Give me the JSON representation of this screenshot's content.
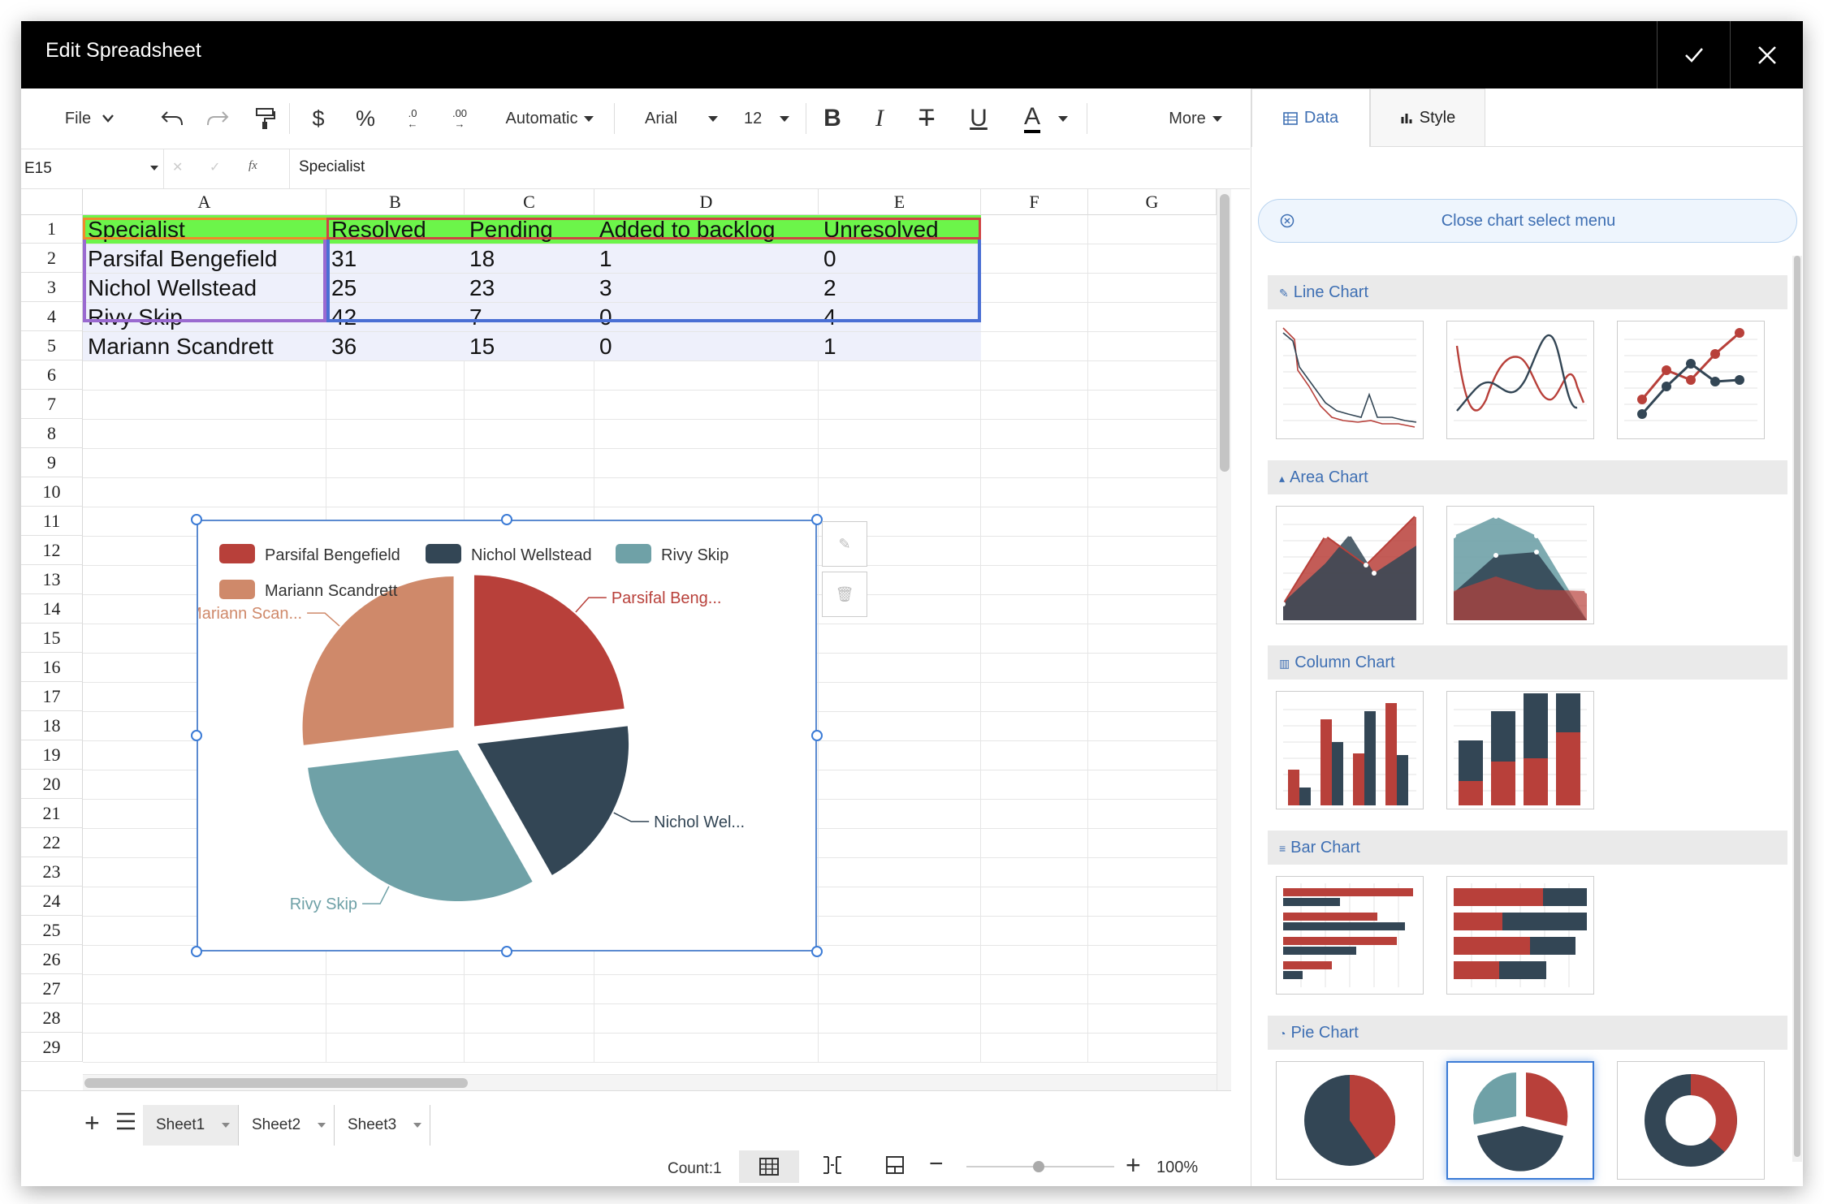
{
  "window": {
    "title": "Edit Spreadsheet"
  },
  "toolbar": {
    "file_label": "File",
    "number_format": "Automatic",
    "font_name": "Arial",
    "font_size": "12",
    "more_label": "More",
    "currency_symbol": "$",
    "percent_symbol": "%",
    "decrease_decimal": ".0",
    "increase_decimal": ".00"
  },
  "formula_bar": {
    "cell_ref": "E15",
    "fx_label": "fx",
    "content": "Specialist"
  },
  "sheet": {
    "columns": [
      "A",
      "B",
      "C",
      "D",
      "E",
      "F",
      "G"
    ],
    "rows": [
      "1",
      "2",
      "3",
      "4",
      "5",
      "6",
      "7",
      "8",
      "9",
      "10",
      "11",
      "12",
      "13",
      "14",
      "15",
      "16",
      "17",
      "18",
      "19",
      "20",
      "21",
      "22",
      "23",
      "24",
      "25",
      "26",
      "27",
      "28",
      "29"
    ],
    "header": [
      "Specialist",
      "Resolved",
      "Pending",
      "Added to backlog",
      "Unresolved"
    ],
    "data": [
      [
        "Parsifal Bengefield",
        "31",
        "18",
        "1",
        "0"
      ],
      [
        "Nichol Wellstead",
        "25",
        "23",
        "3",
        "2"
      ],
      [
        "Rivy Skip",
        "42",
        "7",
        "0",
        "4"
      ],
      [
        "Mariann Scandrett",
        "36",
        "15",
        "0",
        "1"
      ]
    ],
    "header_bg": "#6cf54a",
    "body_bg": "#eef0fb"
  },
  "chart_data": {
    "type": "pie",
    "legend_position": "top-left",
    "slices": [
      {
        "name": "Parsifal Bengefield",
        "label": "Parsifal Beng...",
        "value": 31,
        "color": "#b8403a"
      },
      {
        "name": "Nichol Wellstead",
        "label": "Nichol Wel...",
        "value": 25,
        "color": "#334655"
      },
      {
        "name": "Rivy Skip",
        "label": "Rivy Skip",
        "value": 42,
        "color": "#6fa1a7"
      },
      {
        "name": "Mariann Scandrett",
        "label": "Mariann Scan...",
        "value": 36,
        "color": "#cf896a"
      }
    ]
  },
  "status": {
    "count_label": "Count:1",
    "zoom": "100%",
    "tabs": [
      "Sheet1",
      "Sheet2",
      "Sheet3"
    ],
    "active_tab": "Sheet1"
  },
  "panel": {
    "tabs": [
      "Data",
      "Style"
    ],
    "close_menu_label": "Close chart select menu",
    "sections": [
      "Line Chart",
      "Area Chart",
      "Column Chart",
      "Bar Chart",
      "Pie Chart"
    ]
  },
  "colors": {
    "red": "#b8403a",
    "navy": "#334655",
    "teal": "#6fa1a7",
    "accent": "#3e6fb3"
  }
}
